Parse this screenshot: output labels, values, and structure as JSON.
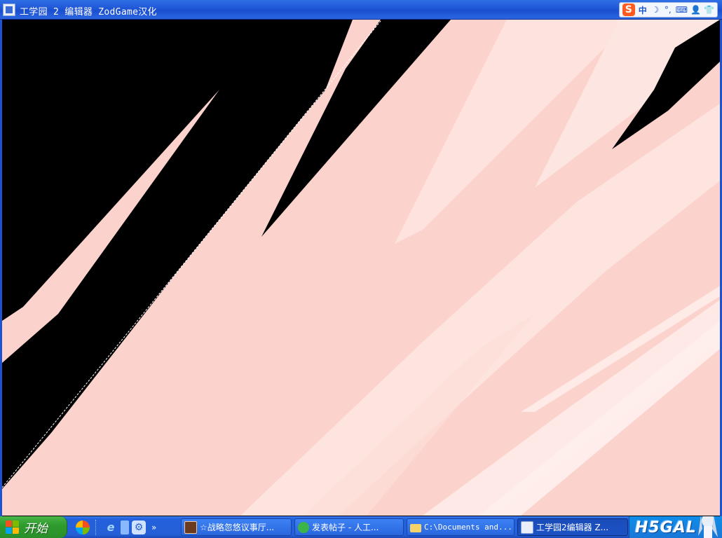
{
  "window": {
    "title": "工学园 2 编辑器 ZodGame汉化"
  },
  "ime_toolbar": {
    "logo": "S",
    "lang": "中",
    "items": [
      "☽",
      "°,",
      "⌨",
      "👤",
      "👕"
    ]
  },
  "colors": {
    "accent_blue": "#2461dc",
    "start_green": "#2f9c2f",
    "wallpaper_pink": "#fcd2cc",
    "wallpaper_light": "#fde6e2"
  },
  "taskbar": {
    "start_label": "开始",
    "quick_launch": [
      {
        "icon": "color-app-icon"
      },
      {
        "icon": "ie-icon"
      },
      {
        "icon": "media-icon"
      },
      {
        "icon": "gear-app-icon"
      }
    ],
    "quick_launch_more": "»",
    "tasks": [
      {
        "label": "☆战略忽悠议事厅...",
        "icon": "game-icon",
        "active": false
      },
      {
        "label": "发表帖子 - 人工...",
        "icon": "ie-icon",
        "active": false
      },
      {
        "label": "C:\\Documents and...",
        "icon": "folder-icon",
        "active": false
      },
      {
        "label": "工学园2编辑器 Z...",
        "icon": "app-icon",
        "active": true
      }
    ],
    "tray_logo": "H5GAL"
  }
}
